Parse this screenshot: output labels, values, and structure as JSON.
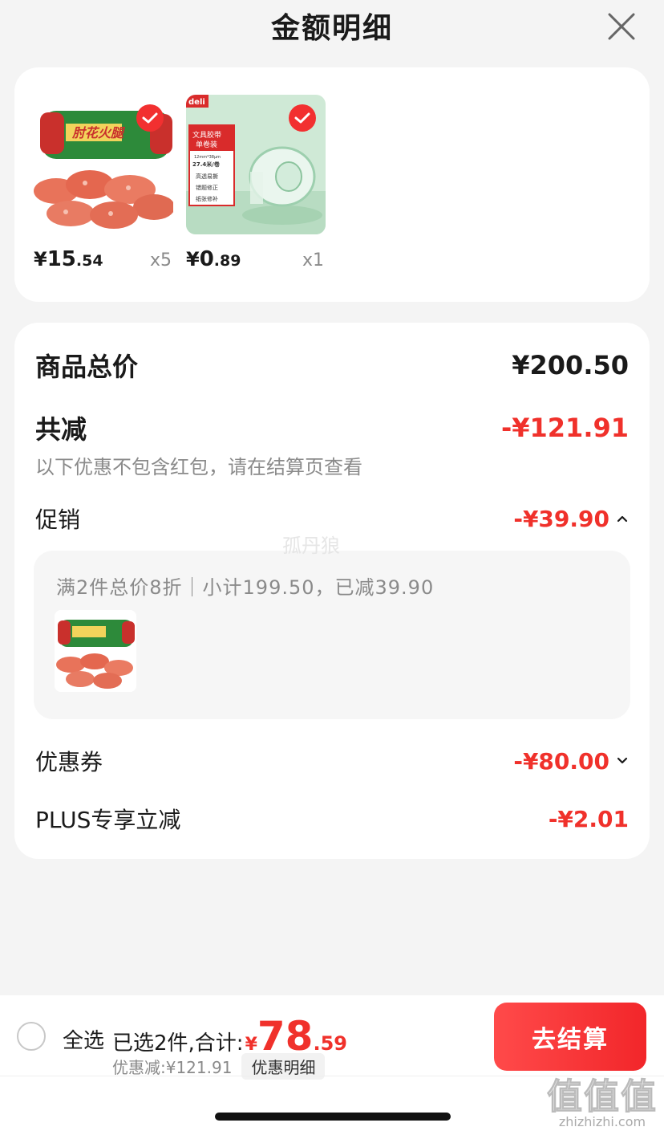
{
  "header": {
    "title": "金额明细"
  },
  "products": [
    {
      "price_yen": "¥",
      "price_int": "15",
      "price_dec": ".54",
      "qty": "x5",
      "icon": "sausage-image"
    },
    {
      "price_yen": "¥",
      "price_int": "0",
      "price_dec": ".89",
      "qty": "x1",
      "icon": "tape-image",
      "packaging": {
        "brand": "deli",
        "line1": "文具胶带",
        "line2": "单卷装",
        "spec": "12mm*38μm",
        "length": "27.4米/卷",
        "feat1": "高透易撕",
        "feat2": "错题修正",
        "feat3": "纸张修补"
      }
    }
  ],
  "detail": {
    "subtotal_label": "商品总价",
    "subtotal_value": "¥200.50",
    "reduction_label": "共减",
    "reduction_value": "-¥121.91",
    "reduction_note": "以下优惠不包含红包，请在结算页查看",
    "promo_label": "促销",
    "promo_value": "-¥39.90",
    "promo_desc": "满2件总价8折｜小计199.50，已减39.90",
    "coupon_label": "优惠券",
    "coupon_value": "-¥80.00",
    "plus_label": "PLUS专享立减",
    "plus_value": "-¥2.01"
  },
  "watermark": "孤丹狼",
  "bottom": {
    "select_all": "全选",
    "summary_text": "已选2件,合计:",
    "total_yen": "¥",
    "total_int": "78",
    "total_dec": ".59",
    "discount_text": "优惠减:¥121.91",
    "detail_link": "优惠明细",
    "checkout": "去结算"
  },
  "site_watermark": {
    "big": "值值值",
    "small": "zhizhizhi.com"
  },
  "colors": {
    "accent": "#f0312b",
    "background": "#f4f4f4"
  }
}
